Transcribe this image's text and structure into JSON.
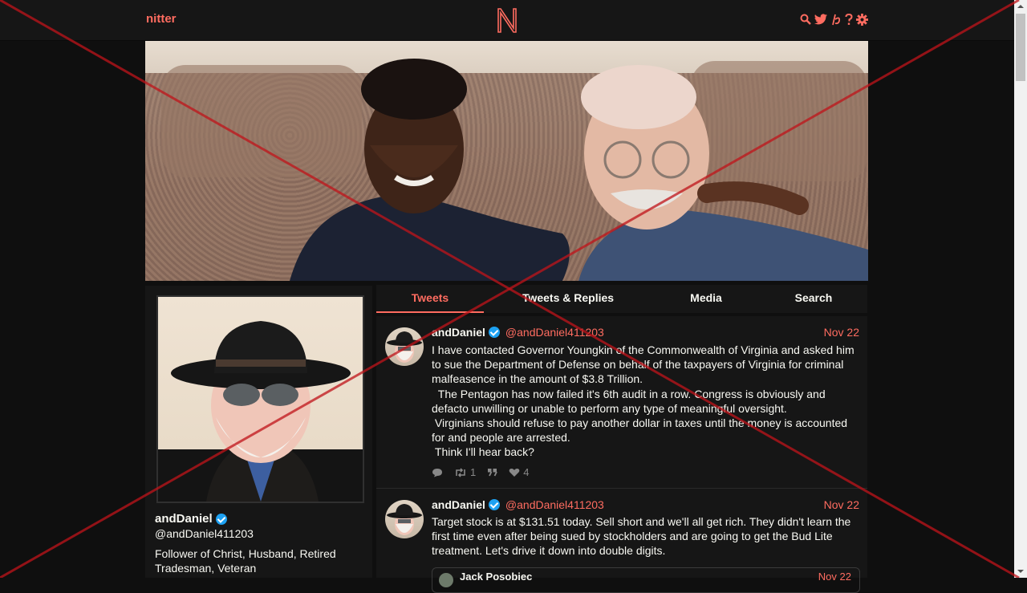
{
  "nav": {
    "brand": "nitter",
    "logo_letter": "N",
    "icons": [
      "search-icon",
      "twitter-icon",
      "rss-icon",
      "help-icon",
      "gear-icon"
    ],
    "accent": "#ff6c60"
  },
  "profile": {
    "fullname": "andDaniel",
    "username": "@andDaniel411203",
    "bio": "Follower of Christ, Husband, Retired Tradesman, Veteran"
  },
  "tabs": [
    {
      "label": "Tweets",
      "active": true
    },
    {
      "label": "Tweets & Replies",
      "active": false
    },
    {
      "label": "Media",
      "active": false
    },
    {
      "label": "Search",
      "active": false
    }
  ],
  "tweets": [
    {
      "fullname": "andDaniel",
      "handle": "@andDaniel411203",
      "date": "Nov 22",
      "body": "I have contacted Governor Youngkin of the Commonwealth of Virginia and asked him to sue the Department of Defense on behalf of the taxpayers of Virginia for criminal malfeasence in the amount of $3.8 Trillion.\n  The Pentagon has now failed it's 6th audit in a row. Congress is obviously and defacto unwilling or unable to perform any type of meaningful oversight.\n Virginians should refuse to pay another dollar in taxes until the money is accounted for and people are arrested.\n Think I'll hear back?",
      "retweets": "1",
      "likes": "4"
    },
    {
      "fullname": "andDaniel",
      "handle": "@andDaniel411203",
      "date": "Nov 22",
      "body": "Target stock is at $131.51 today. Sell short and we'll all get rich. They didn't learn the first time even after being sued by stockholders and are going to get the Bud Lite treatment. Let's drive it down into double digits.",
      "quote_name": "Jack Posobiec",
      "quote_date": "Nov 22"
    }
  ],
  "colors": {
    "background": "#0f0f0f",
    "panel": "#161616",
    "text": "#f8f8f2",
    "accent": "#ff6c60",
    "muted": "#888888",
    "verified": "#1da1f2",
    "overlay_x": "#c0141a"
  }
}
